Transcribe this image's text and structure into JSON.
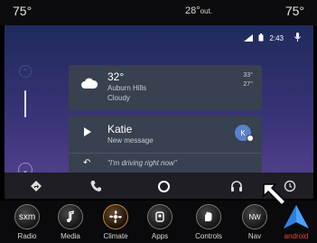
{
  "top_bar": {
    "temp_left": "75°",
    "outside_temp": "28°",
    "outside_label": "out.",
    "temp_right": "75°"
  },
  "status_bar": {
    "time": "2:43",
    "icons": [
      "signal-icon",
      "battery-icon",
      "mic-icon"
    ]
  },
  "weather_card": {
    "temp": "32°",
    "location": "Auburn Hills",
    "condition": "Cloudy",
    "high": "33°",
    "low": "27°",
    "icon": "cloud-icon"
  },
  "message_card": {
    "sender": "Katie",
    "subtitle": "New message",
    "avatar_initial": "K",
    "reply_text": "\"I'm driving right now\"",
    "icons": [
      "play-icon",
      "reply-icon"
    ]
  },
  "nav_bar": {
    "icons": [
      "navigation-icon",
      "phone-icon",
      "home-icon",
      "headphones-icon",
      "overview-icon"
    ]
  },
  "dock": {
    "items": [
      {
        "label": "Radio",
        "icon": "radio-icon",
        "icon_text": "sxm"
      },
      {
        "label": "Media",
        "icon": "media-icon"
      },
      {
        "label": "Climate",
        "icon": "climate-icon"
      },
      {
        "label": "Apps",
        "icon": "apps-icon"
      },
      {
        "label": "Controls",
        "icon": "controls-icon"
      },
      {
        "label": "Nav",
        "icon": "nav-icon",
        "icon_text": "NW"
      },
      {
        "label": "android",
        "icon": "android-auto-icon"
      }
    ],
    "accent_color": "#e8462f"
  }
}
